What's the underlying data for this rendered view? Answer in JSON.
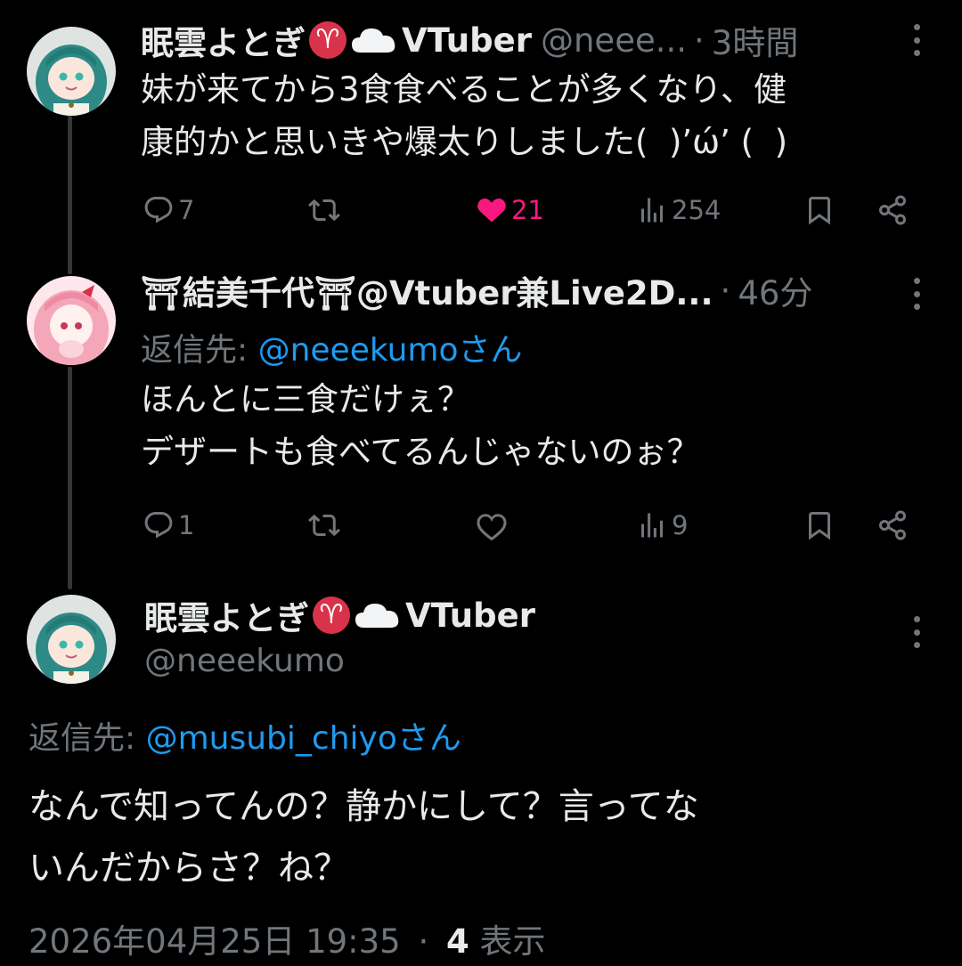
{
  "tweets": [
    {
      "display_name": "眠雲よとぎ",
      "aries_emoji": "♈",
      "name_suffix": "VTuber",
      "handle": "@neee...",
      "separator": "·",
      "time": "3時間",
      "text": "妹が来てから3食食べることが多くなり、健\n康的かと思いきや爆太りしました(  )’ώ’ (  )",
      "stats": {
        "replies": "7",
        "likes": "21",
        "views": "254"
      }
    },
    {
      "display_name": "⛩結美千代⛩@Vtuber兼Live2D...",
      "separator": "·",
      "time": "46分",
      "reply_prefix": "返信先:",
      "reply_to": "@neeekumoさん",
      "text": "ほんとに三食だけぇ？\nデザートも食べてるんじゃないのぉ？",
      "stats": {
        "replies": "1",
        "views": "9"
      }
    },
    {
      "display_name": "眠雲よとぎ",
      "aries_emoji": "♈",
      "name_suffix": "VTuber",
      "handle": "@neeekumo",
      "reply_prefix": "返信先:",
      "reply_to": "@musubi_chiyoさん",
      "text": "なんで知ってんの？静かにして？言ってな\nいんだからさ？ね？",
      "timestamp": "2026年04月25日 19:35",
      "separator": "·",
      "views_count": "4",
      "views_label": "表示"
    }
  ],
  "colors": {
    "background": "#000000",
    "text": "#e7e9ea",
    "muted": "#71767b",
    "link": "#1d9bf0",
    "like": "#f91880",
    "aries_badge": "#d9334b"
  },
  "icons": [
    "reply-icon",
    "retweet-icon",
    "like-icon",
    "views-icon",
    "bookmark-icon",
    "share-icon",
    "more-icon",
    "cloud-icon"
  ]
}
